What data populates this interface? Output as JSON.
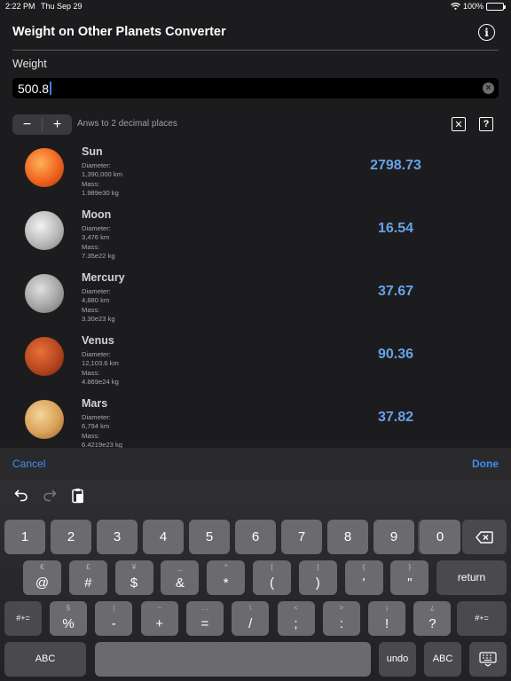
{
  "status": {
    "time": "2:22 PM",
    "date": "Thu Sep 29",
    "battery": "100%"
  },
  "header": {
    "title": "Weight on Other Planets Converter",
    "info_icon": "info-icon"
  },
  "weight": {
    "label": "Weight",
    "value": "500.8"
  },
  "stepper": {
    "minus": "−",
    "plus": "+"
  },
  "decimals_text": "Anws to 2 decimal places",
  "planets": [
    {
      "name": "Sun",
      "diameter_label": "Diameter:",
      "diameter": "1,390,000 km",
      "mass_label": "Mass:",
      "mass": "1.989e30 kg",
      "result": "2798.73"
    },
    {
      "name": "Moon",
      "diameter_label": "Diameter:",
      "diameter": "3,476 km",
      "mass_label": "Mass:",
      "mass": "7.35e22 kg",
      "result": "16.54"
    },
    {
      "name": "Mercury",
      "diameter_label": "Diameter:",
      "diameter": "4,880 km",
      "mass_label": "Mass:",
      "mass": "3.30e23 kg",
      "result": "37.67"
    },
    {
      "name": "Venus",
      "diameter_label": "Diameter:",
      "diameter": "12,103.6 km",
      "mass_label": "Mass:",
      "mass": "4.869e24 kg",
      "result": "90.36"
    },
    {
      "name": "Mars",
      "diameter_label": "Diameter:",
      "diameter": "6,794 km",
      "mass_label": "Mass:",
      "mass": "6.4219e23 kg",
      "result": "37.82"
    }
  ],
  "keyboard_bar": {
    "cancel": "Cancel",
    "done": "Done"
  },
  "keyboard": {
    "row1": [
      "1",
      "2",
      "3",
      "4",
      "5",
      "6",
      "7",
      "8",
      "9",
      "0"
    ],
    "row2": [
      [
        "€",
        "@"
      ],
      [
        "£",
        "#"
      ],
      [
        "¥",
        "$"
      ],
      [
        "_",
        "&"
      ],
      [
        "^",
        "*"
      ],
      [
        "[",
        "("
      ],
      [
        "]",
        ")"
      ],
      [
        "{",
        "'"
      ],
      [
        "}",
        "\""
      ]
    ],
    "return": "return",
    "shift_symbols": "#+=",
    "row3": [
      [
        "§",
        "%"
      ],
      [
        "|",
        "-"
      ],
      [
        "~",
        "+"
      ],
      [
        "…",
        "="
      ],
      [
        "\\",
        "/"
      ],
      [
        "<",
        ";"
      ],
      [
        ">",
        ":"
      ],
      [
        "¡",
        "!"
      ],
      [
        "¿",
        "?"
      ]
    ],
    "abc": "ABC",
    "undo": "undo"
  },
  "colors": {
    "accent": "#3f8ff0",
    "result": "#66a3e8"
  }
}
